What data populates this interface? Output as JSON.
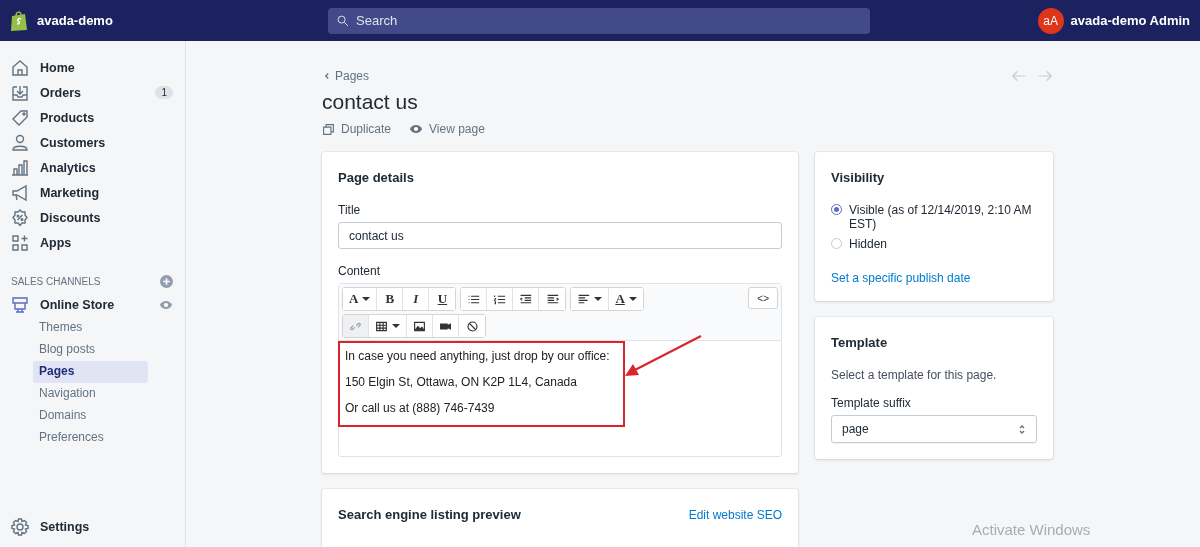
{
  "topbar": {
    "store_name": "avada-demo",
    "search": {
      "placeholder": "Search"
    },
    "avatar_initials": "aA",
    "user_name": "avada-demo Admin"
  },
  "sidebar": {
    "items": [
      {
        "label": "Home",
        "selected": false
      },
      {
        "label": "Orders",
        "badge": "1",
        "selected": false
      },
      {
        "label": "Products",
        "selected": false
      },
      {
        "label": "Customers",
        "selected": false
      },
      {
        "label": "Analytics",
        "selected": false
      },
      {
        "label": "Marketing",
        "selected": false
      },
      {
        "label": "Discounts",
        "selected": false
      },
      {
        "label": "Apps",
        "selected": false
      }
    ],
    "section_title": "SALES CHANNELS",
    "channel": {
      "label": "Online Store",
      "children": [
        {
          "label": "Themes",
          "selected": false
        },
        {
          "label": "Blog posts",
          "selected": false
        },
        {
          "label": "Pages",
          "selected": true
        },
        {
          "label": "Navigation",
          "selected": false
        },
        {
          "label": "Domains",
          "selected": false
        },
        {
          "label": "Preferences",
          "selected": false
        }
      ]
    },
    "settings": "Settings"
  },
  "page": {
    "breadcrumb": "Pages",
    "title": "contact us",
    "actions": [
      "Duplicate",
      "View page"
    ]
  },
  "page_details": {
    "heading": "Page details",
    "title_label": "Title",
    "title_value": "contact us",
    "content_label": "Content",
    "toolbar": [
      [
        {
          "kind": "glyph",
          "label": "A",
          "caret": true,
          "disabled": false
        },
        {
          "kind": "glyph",
          "label": "B",
          "caret": false,
          "disabled": false
        },
        {
          "kind": "glyph",
          "label": "I",
          "caret": false,
          "disabled": false
        },
        {
          "kind": "glyph",
          "label": "U",
          "caret": false,
          "disabled": false
        }
      ],
      [
        {
          "kind": "icon",
          "caret": false,
          "disabled": false
        },
        {
          "kind": "icon",
          "caret": false,
          "disabled": false
        },
        {
          "kind": "icon",
          "caret": false,
          "disabled": false
        },
        {
          "kind": "icon",
          "caret": false,
          "disabled": false
        }
      ],
      [
        {
          "kind": "icon",
          "caret": true,
          "disabled": false
        },
        {
          "kind": "glyph",
          "label": "A",
          "caret": true,
          "disabled": false
        }
      ]
    ],
    "toolbar_row2": [
      {
        "kind": "icon",
        "caret": false,
        "disabled": true
      },
      {
        "kind": "icon",
        "caret": true,
        "disabled": false
      },
      {
        "kind": "icon",
        "caret": false,
        "disabled": false
      },
      {
        "kind": "icon",
        "caret": false,
        "disabled": false
      },
      {
        "kind": "icon",
        "caret": false,
        "disabled": false
      }
    ],
    "html_button": "<>",
    "content_lines": [
      "In case you need anything, just drop by our office:",
      "150 Elgin St, Ottawa, ON K2P 1L4, Canada",
      "Or call us at (888) 746-7439"
    ]
  },
  "seo": {
    "heading": "Search engine listing preview",
    "link": "Edit website SEO"
  },
  "visibility": {
    "heading": "Visibility",
    "options": [
      {
        "label": "Visible (as of 12/14/2019, 2:10 AM EST)",
        "selected": true
      },
      {
        "label": "Hidden",
        "selected": false
      }
    ],
    "link": "Set a specific publish date"
  },
  "template": {
    "heading": "Template",
    "description": "Select a template for this page.",
    "suffix_label": "Template suffix",
    "suffix_value": "page"
  },
  "os_notice": "Activate Windows"
}
